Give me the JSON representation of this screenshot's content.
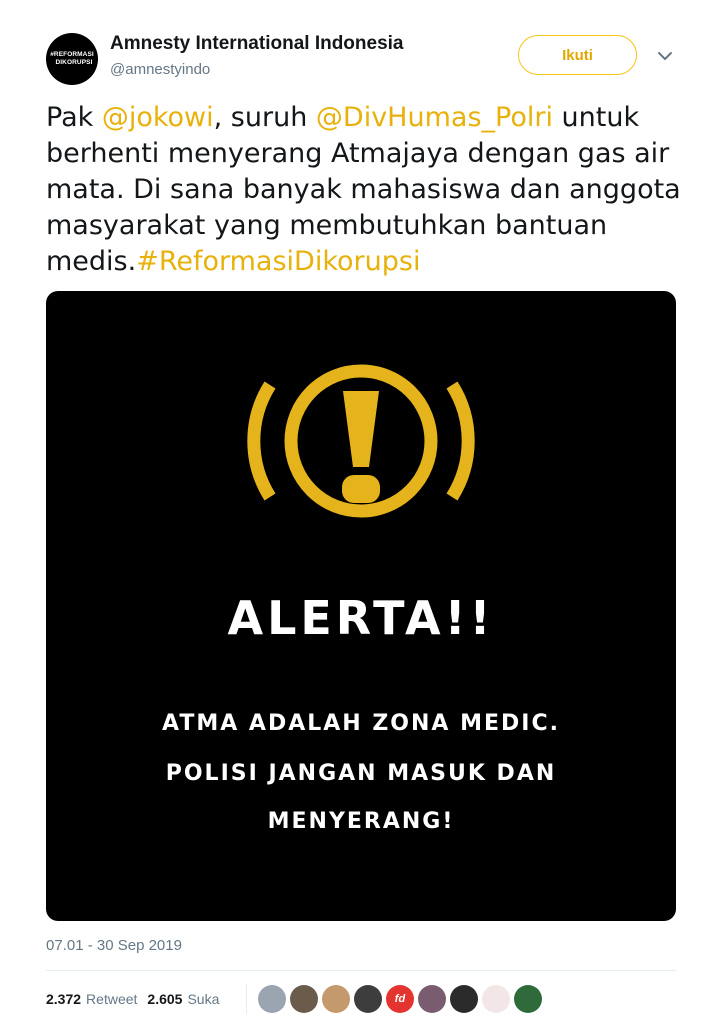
{
  "account": {
    "display_name": "Amnesty International Indonesia",
    "handle": "@amnestyindo",
    "avatar_line1": "#REFORMASI",
    "avatar_line2": "DIKORUPSI"
  },
  "follow_button": {
    "label": "Ikuti"
  },
  "tweet": {
    "segments": [
      {
        "text": "Pak ",
        "link": false
      },
      {
        "text": "@jokowi",
        "link": true
      },
      {
        "text": ", suruh ",
        "link": false
      },
      {
        "text": "@DivHumas_Polri",
        "link": true
      },
      {
        "text": " untuk berhenti menyerang Atmajaya dengan gas air mata. Di sana banyak mahasiswa dan anggota masyarakat yang membutuhkan bantuan medis.",
        "link": false
      },
      {
        "text": "#ReformasiDikorupsi",
        "link": true
      }
    ]
  },
  "media": {
    "icon": "warning-exclamation-icon",
    "headline": "ALERTA!!",
    "message_line1": "ATMA ADALAH ZONA MEDIC.",
    "message_line2": "POLISI JANGAN MASUK DAN",
    "message_line3": "MENYERANG!"
  },
  "timestamp": "07.01 - 30 Sep 2019",
  "stats": {
    "retweet_count": "2.372",
    "retweet_label": "Retweet",
    "like_count": "2.605",
    "like_label": "Suka"
  },
  "likers": [
    {
      "name": "liker-avatar-1",
      "color": "#9aa5b1",
      "glyph": ""
    },
    {
      "name": "liker-avatar-2",
      "color": "#6b5b4b",
      "glyph": ""
    },
    {
      "name": "liker-avatar-3",
      "color": "#c49a6c",
      "glyph": ""
    },
    {
      "name": "liker-avatar-4",
      "color": "#3d3d3d",
      "glyph": ""
    },
    {
      "name": "liker-avatar-5",
      "color": "#e3342f",
      "glyph": "fd"
    },
    {
      "name": "liker-avatar-6",
      "color": "#7a5c70",
      "glyph": ""
    },
    {
      "name": "liker-avatar-7",
      "color": "#2b2b2b",
      "glyph": ""
    },
    {
      "name": "liker-avatar-8",
      "color": "#f2e6e6",
      "glyph": ""
    },
    {
      "name": "liker-avatar-9",
      "color": "#2f6b3a",
      "glyph": ""
    }
  ],
  "colors": {
    "accent": "#e8b10b",
    "alert_yellow": "#e5b31b"
  }
}
